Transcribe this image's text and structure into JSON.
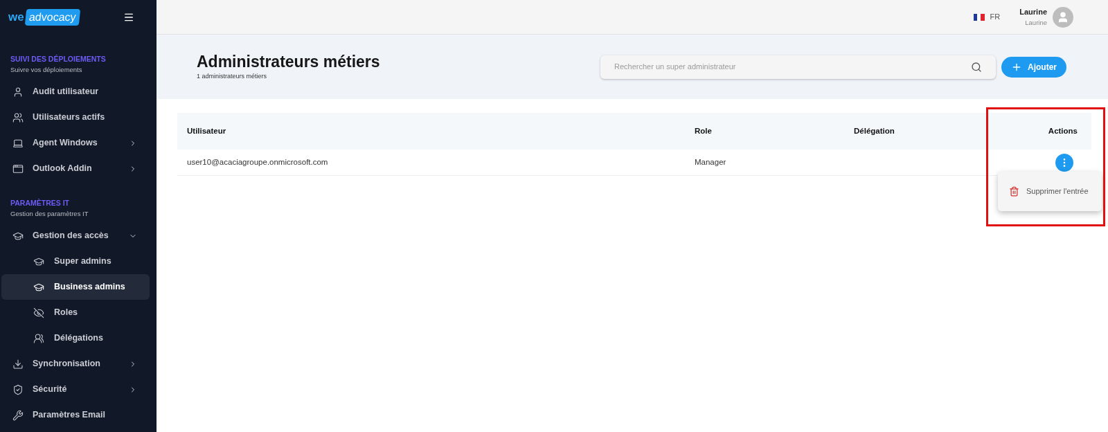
{
  "logo": {
    "prefix": "we",
    "name": "advocacy"
  },
  "sidebar": {
    "sections": [
      {
        "title": "SUIVI DES DÉPLOIEMENTS",
        "subtitle": "Suivre vos déploiements",
        "items": [
          {
            "label": "Audit utilisateur",
            "selected": false
          },
          {
            "label": "Utilisateurs actifs",
            "selected": false
          },
          {
            "label": "Agent Windows",
            "selected": false,
            "expanded": false
          },
          {
            "label": "Outlook Addin",
            "selected": false,
            "expanded": false
          }
        ]
      },
      {
        "title": "PARAMÈTRES IT",
        "subtitle": "Gestion des paramètres IT",
        "items": [
          {
            "label": "Gestion des accès",
            "selected": false,
            "expanded": true,
            "children": [
              {
                "label": "Super admins",
                "selected": false
              },
              {
                "label": "Business admins",
                "selected": true
              },
              {
                "label": "Roles",
                "selected": false
              },
              {
                "label": "Délégations",
                "selected": false
              }
            ]
          },
          {
            "label": "Synchronisation",
            "selected": false,
            "expanded": false
          },
          {
            "label": "Sécurité",
            "selected": false,
            "expanded": false
          },
          {
            "label": "Paramètres Email",
            "selected": false
          }
        ]
      }
    ]
  },
  "topbar": {
    "language": "FR",
    "user": {
      "name": "Laurine",
      "subtitle": "Laurine"
    }
  },
  "header": {
    "title": "Administrateurs métiers",
    "count": "1 administrateurs métiers",
    "search": {
      "placeholder": "Rechercher un super administrateur"
    },
    "add_button": "Ajouter"
  },
  "table": {
    "columns": [
      "Utilisateur",
      "Role",
      "Délégation",
      "Actions"
    ],
    "rows": [
      {
        "user": "user10@acaciagroupe.onmicrosoft.com",
        "role": "Manager"
      }
    ]
  },
  "action_menu": {
    "items": [
      "Supprimer l'entrée"
    ]
  }
}
